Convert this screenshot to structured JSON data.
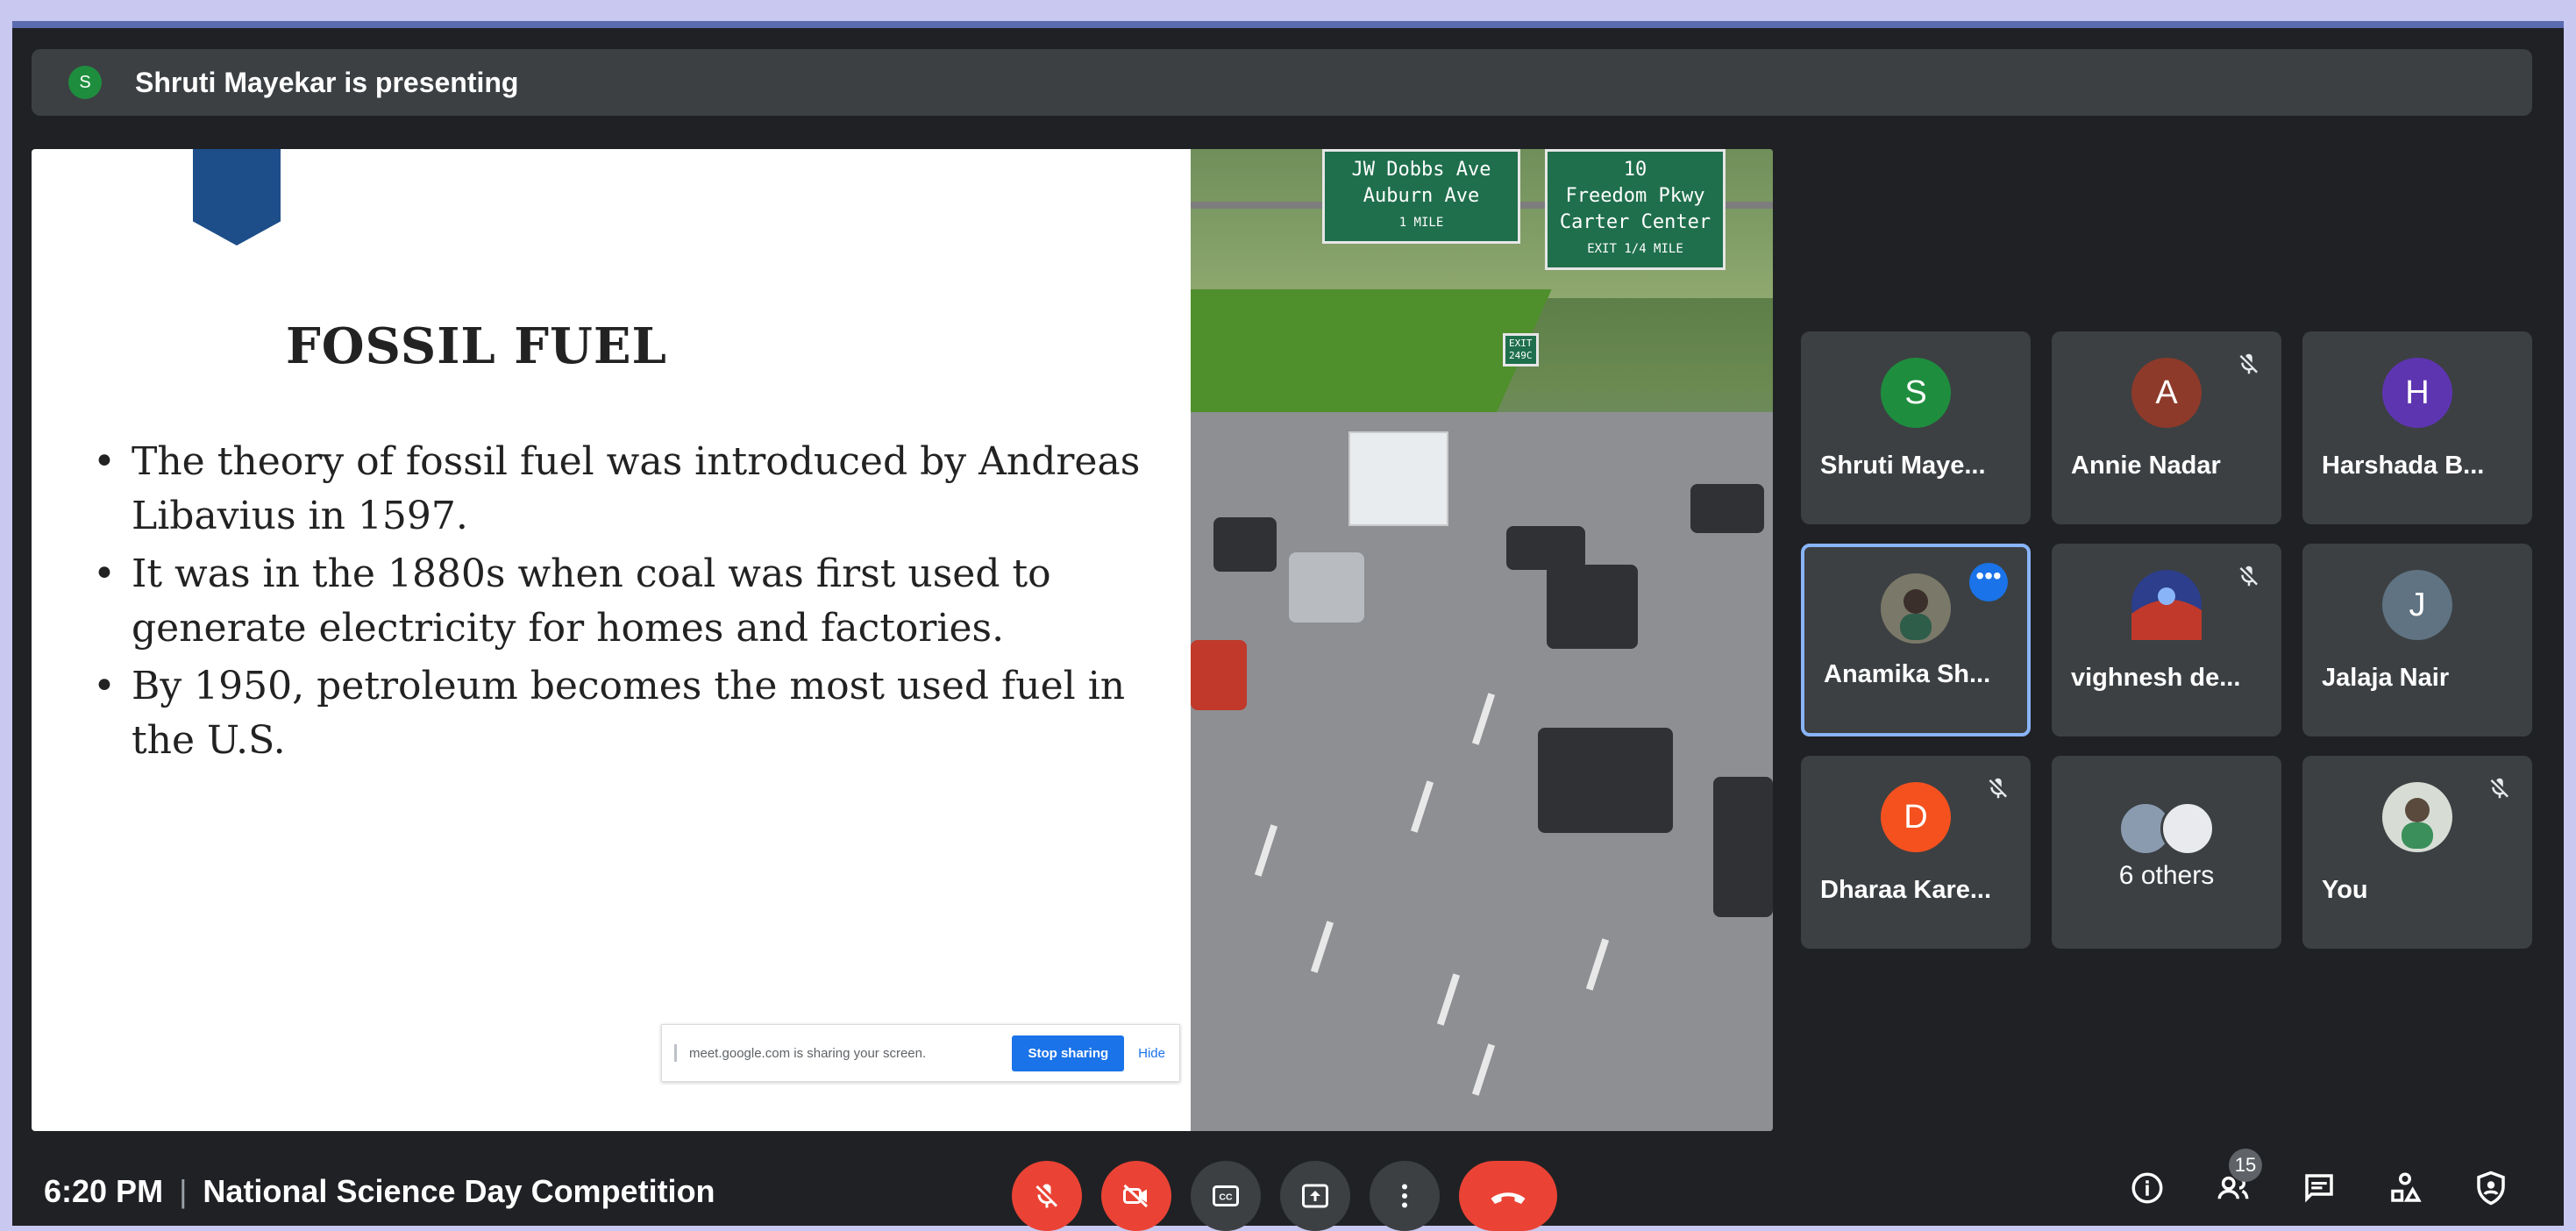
{
  "presenting": {
    "avatar_letter": "S",
    "text": "Shruti Mayekar is presenting"
  },
  "slide": {
    "title": "FOSSIL FUEL",
    "bullets": [
      "The theory of fossil fuel was introduced by Andreas Libavius in 1597.",
      "It was in the 1880s when coal was first used to generate electricity for homes and factories.",
      "By 1950, petroleum becomes the most used fuel in the U.S."
    ],
    "road_signs": {
      "left": [
        "JW Dobbs Ave",
        "Auburn Ave",
        "1 MILE"
      ],
      "right": [
        "10",
        "Freedom Pkwy",
        "Carter Center",
        "EXIT 1/4 MILE"
      ],
      "exit": [
        "EXIT",
        "249C"
      ]
    }
  },
  "share_banner": {
    "text": "meet.google.com is sharing your screen.",
    "stop_label": "Stop sharing",
    "hide_label": "Hide"
  },
  "participants": [
    {
      "name": "Shruti Maye...",
      "letter": "S",
      "color": "#1e8e3e",
      "muted": false
    },
    {
      "name": "Annie Nadar",
      "letter": "A",
      "color": "#8d3a2a",
      "muted": true
    },
    {
      "name": "Harshada B...",
      "letter": "H",
      "color": "#5e35b1",
      "muted": false
    },
    {
      "name": "Anamika Sh...",
      "letter": "",
      "color": "#6d6f5e",
      "muted": false,
      "active": true
    },
    {
      "name": "vighnesh de...",
      "letter": "",
      "color": "#3b5aa8",
      "muted": true
    },
    {
      "name": "Jalaja Nair",
      "letter": "J",
      "color": "#5f7382",
      "muted": false
    },
    {
      "name": "Dharaa Kare...",
      "letter": "D",
      "color": "#f4511e",
      "muted": true
    },
    {
      "name": "You",
      "letter": "",
      "color": "#7a8f7a",
      "muted": true
    }
  ],
  "others": {
    "label": "6 others"
  },
  "meeting": {
    "time": "6:20 PM",
    "separator": "|",
    "title": "National Science Day Competition"
  },
  "participants_count": "15",
  "colors": {
    "accent": "#1a73e8",
    "danger": "#ea4335",
    "surface": "#3c4043",
    "background": "#202124"
  }
}
